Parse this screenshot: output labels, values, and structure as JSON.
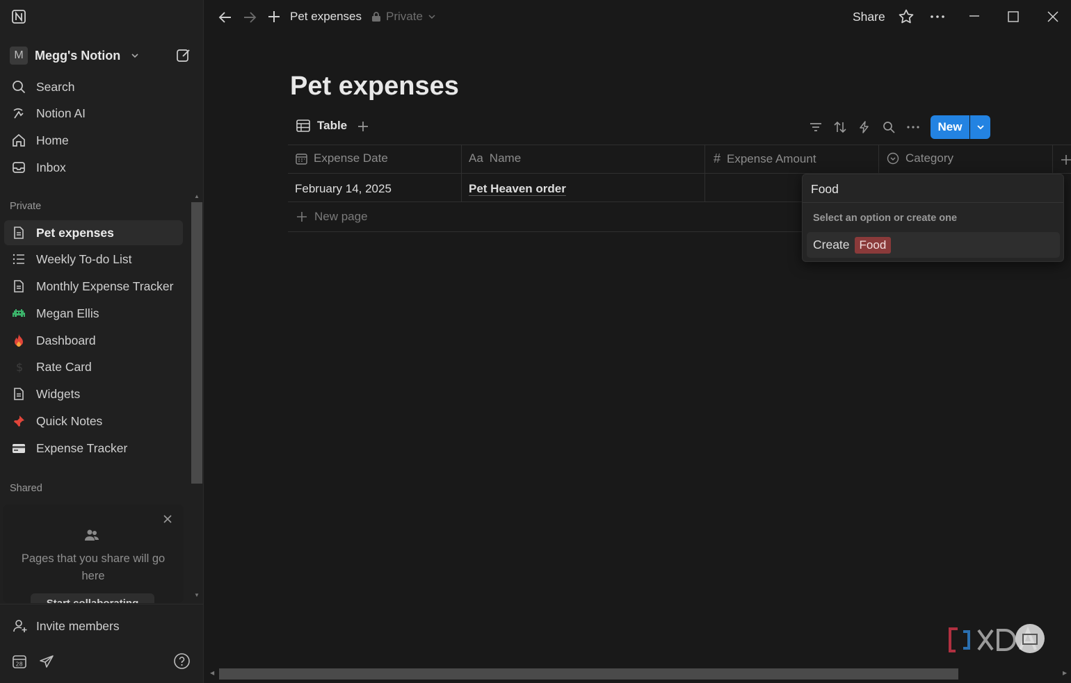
{
  "window": {
    "breadcrumb": "Pet expenses",
    "privacy": "Private",
    "share_label": "Share"
  },
  "sidebar": {
    "workspace_initial": "M",
    "workspace_name": "Megg's Notion",
    "nav": [
      {
        "label": "Search",
        "icon": "search-icon"
      },
      {
        "label": "Notion AI",
        "icon": "notion-ai-icon"
      },
      {
        "label": "Home",
        "icon": "home-icon"
      },
      {
        "label": "Inbox",
        "icon": "inbox-icon"
      }
    ],
    "private_label": "Private",
    "pages": [
      {
        "label": "Pet expenses",
        "icon": "page-icon",
        "active": true
      },
      {
        "label": "Weekly To-do List",
        "icon": "list-icon"
      },
      {
        "label": "Monthly Expense Tracker",
        "icon": "page-icon"
      },
      {
        "label": "Megan Ellis",
        "icon": "space-invader-icon"
      },
      {
        "label": "Dashboard",
        "icon": "fire-icon"
      },
      {
        "label": "Rate Card",
        "icon": "dollar-icon"
      },
      {
        "label": "Widgets",
        "icon": "page-icon"
      },
      {
        "label": "Quick Notes",
        "icon": "pushpin-icon"
      },
      {
        "label": "Expense Tracker",
        "icon": "card-icon"
      }
    ],
    "shared_label": "Shared",
    "shared_empty_text": "Pages that you share will go here",
    "shared_button": "Start collaborating",
    "invite_label": "Invite members"
  },
  "page": {
    "title": "Pet expenses",
    "view_tab": "Table",
    "new_button": "New",
    "columns": [
      {
        "label": "Expense Date",
        "icon": "calendar-icon"
      },
      {
        "label": "Name",
        "icon": "text-aa-icon",
        "icon_text": "Aa"
      },
      {
        "label": "Expense Amount",
        "icon": "hash-icon",
        "icon_text": "#"
      },
      {
        "label": "Category",
        "icon": "select-icon"
      }
    ],
    "rows": [
      {
        "date": "February 14, 2025",
        "name": "Pet Heaven order",
        "amount": "",
        "category": ""
      }
    ],
    "new_row_label": "New page"
  },
  "popup": {
    "input_value": "Food",
    "hint": "Select an option or create one",
    "create_label": "Create",
    "create_tag": "Food",
    "tag_color": "#8a3a3a"
  },
  "colors": {
    "accent": "#2383e2",
    "background": "#191919",
    "sidebar": "#202020"
  }
}
